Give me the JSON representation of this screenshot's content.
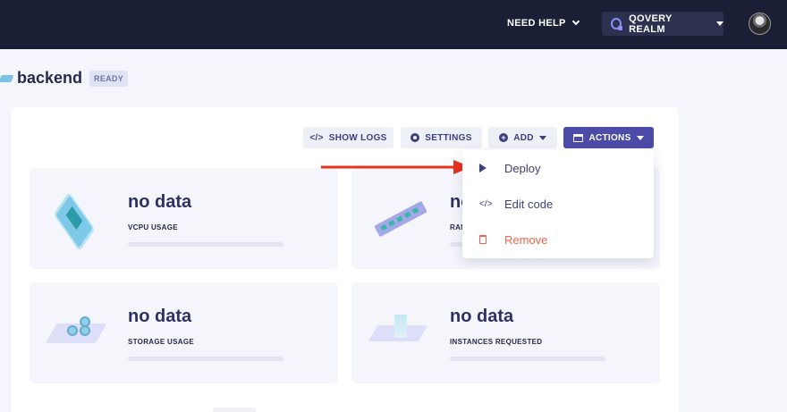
{
  "topbar": {
    "help_label": "NEED HELP",
    "realm_label": "QOVERY REALM",
    "icons": {
      "help_chevron": "chevron-down-icon",
      "realm_logo": "qovery-logo-icon",
      "realm_caret": "caret-down-icon",
      "avatar": "user-avatar"
    }
  },
  "page": {
    "title": "backend",
    "status": "READY"
  },
  "toolbar": {
    "logs_label": "SHOW LOGS",
    "settings_label": "SETTINGS",
    "add_label": "ADD",
    "actions_label": "ACTIONS",
    "logs_icon": "</>"
  },
  "cards": [
    {
      "value": "no data",
      "label": "VCPU USAGE"
    },
    {
      "value": "no data",
      "label": "RAM USAGE"
    },
    {
      "value": "no data",
      "label": "STORAGE USAGE"
    },
    {
      "value": "no data",
      "label": "INSTANCES REQUESTED"
    }
  ],
  "actions_menu": {
    "items": [
      {
        "label": "Deploy",
        "icon": "play-icon"
      },
      {
        "label": "Edit code",
        "icon": "</>"
      },
      {
        "label": "Remove",
        "icon": "trash-icon"
      }
    ]
  },
  "colors": {
    "topbar": "#1b1f36",
    "primary": "#4c4ba8",
    "danger": "#f2634d",
    "annotation_arrow": "#e8321e"
  }
}
